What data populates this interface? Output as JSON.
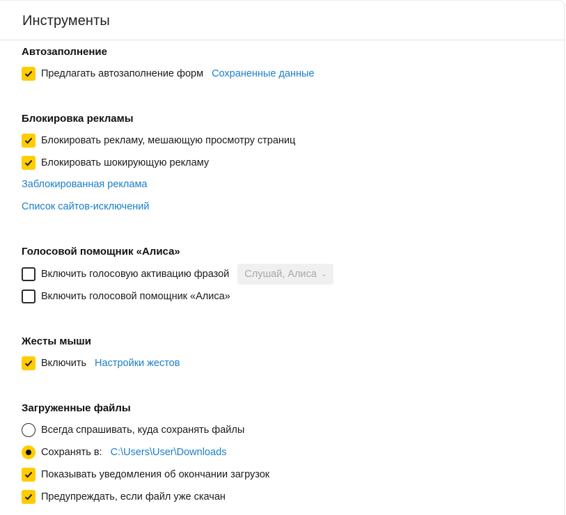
{
  "header": {
    "title": "Инструменты"
  },
  "autofill": {
    "title": "Автозаполнение",
    "offer_label": "Предлагать автозаполнение форм",
    "offer_checked": true,
    "saved_data_link": "Сохраненные данные"
  },
  "adblock": {
    "title": "Блокировка рекламы",
    "block_intrusive_label": "Блокировать рекламу, мешающую просмотру страниц",
    "block_intrusive_checked": true,
    "block_shocking_label": "Блокировать шокирующую рекламу",
    "block_shocking_checked": true,
    "blocked_ads_link": "Заблокированная реклама",
    "exceptions_link": "Список сайтов-исключений"
  },
  "alice": {
    "title": "Голосовой помощник «Алиса»",
    "phrase_activation_label": "Включить голосовую активацию фразой",
    "phrase_activation_checked": false,
    "phrase_select_value": "Слушай, Алиса",
    "enable_assistant_label": "Включить голосовой помощник «Алиса»",
    "enable_assistant_checked": false
  },
  "gestures": {
    "title": "Жесты мыши",
    "enable_label": "Включить",
    "enable_checked": true,
    "settings_link": "Настройки жестов"
  },
  "downloads": {
    "title": "Загруженные файлы",
    "always_ask_label": "Всегда спрашивать, куда сохранять файлы",
    "save_to_label": "Сохранять в:",
    "save_to_path": "C:\\Users\\User\\Downloads",
    "selected_option": "save_to",
    "notify_label": "Показывать уведомления об окончании загрузок",
    "notify_checked": true,
    "warn_label": "Предупреждать, если файл уже скачан",
    "warn_checked": true
  },
  "colors": {
    "accent": "#ffcc00",
    "link": "#1a7ec8"
  },
  "icons": {
    "check": "checkmark-icon",
    "chevron": "chevron-down-icon"
  }
}
